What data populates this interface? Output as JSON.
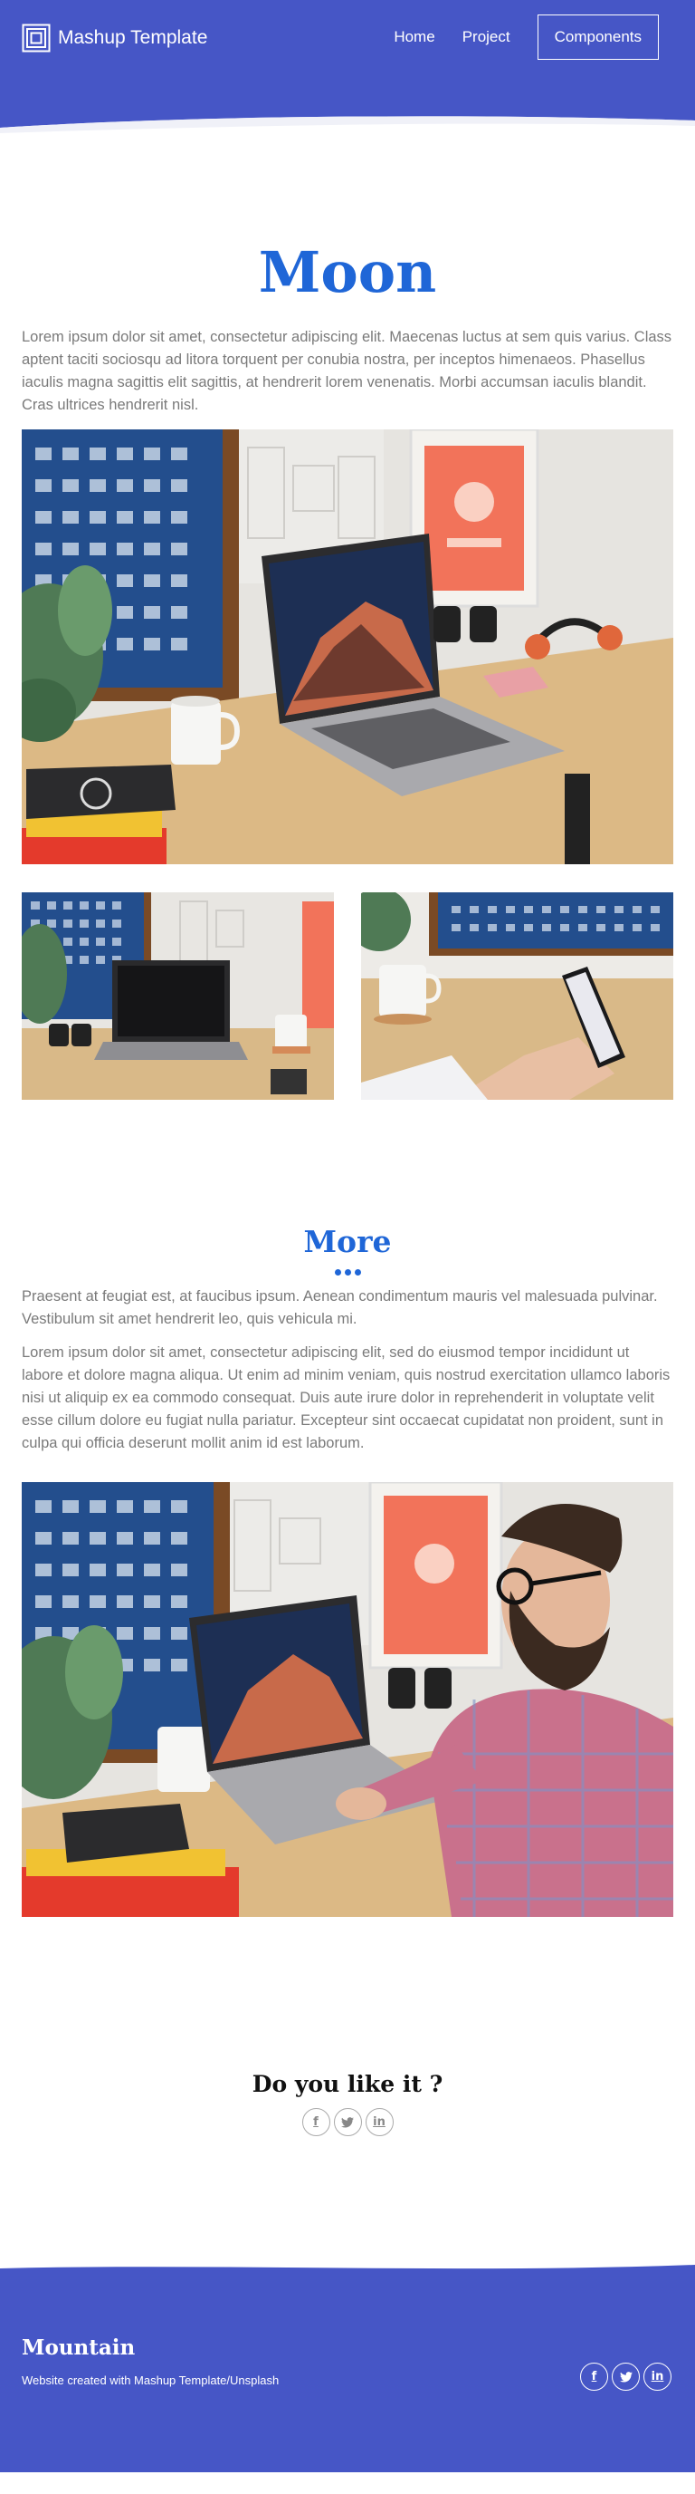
{
  "header": {
    "brand": "Mashup Template",
    "nav": {
      "home": "Home",
      "project": "Project",
      "components": "Components"
    }
  },
  "main": {
    "title": "Moon",
    "intro": "Lorem ipsum dolor sit amet, consectetur adipiscing elit. Maecenas luctus at sem quis varius. Class aptent taciti sociosqu ad litora torquent per conubia nostra, per inceptos himenaeos. Phasellus iaculis magna sagittis elit sagittis, at hendrerit lorem venenatis. Morbi accumsan iaculis blandit. Cras ultrices hendrerit nisl.",
    "more_title": "More",
    "more_p1": "Praesent at feugiat est, at faucibus ipsum. Aenean condimentum mauris vel malesuada pulvinar. Vestibulum sit amet hendrerit leo, quis vehicula mi.",
    "more_p2": "Lorem ipsum dolor sit amet, consectetur adipiscing elit, sed do eiusmod tempor incididunt ut labore et dolore magna aliqua. Ut enim ad minim veniam, quis nostrud exercitation ullamco laboris nisi ut aliquip ex ea commodo consequat. Duis aute irure dolor in reprehenderit in voluptate velit esse cillum dolore eu fugiat nulla pariatur. Excepteur sint occaecat cupidatat non proident, sunt in culpa qui officia deserunt mollit anim id est laborum.",
    "like_title": "Do you like it ?"
  },
  "social": [
    {
      "icon": "facebook-icon",
      "glyph": "f"
    },
    {
      "icon": "twitter-icon",
      "glyph": "t"
    },
    {
      "icon": "linkedin-icon",
      "glyph": "in"
    }
  ],
  "footer": {
    "title": "Mountain",
    "credit": "Website created with Mashup Template/Unsplash"
  },
  "colors": {
    "brand_blue": "#4656c6",
    "heading_blue": "#1f66d7"
  }
}
